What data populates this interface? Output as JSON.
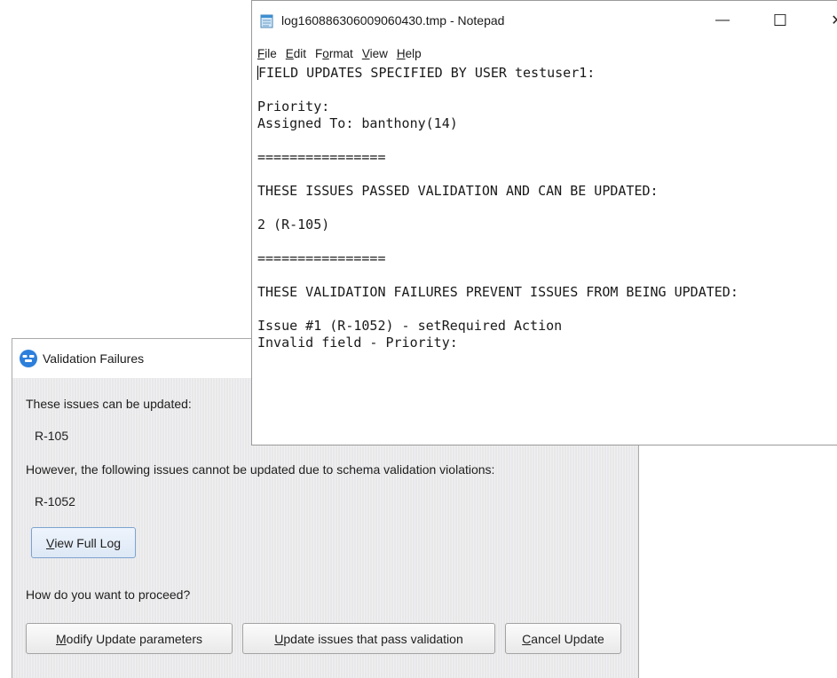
{
  "notepad": {
    "title": "log160886306009060430.tmp - Notepad",
    "window_controls": {
      "minimize": "—",
      "maximize": "☐",
      "close": "✕"
    },
    "menu": [
      {
        "pre": "",
        "mn": "F",
        "post": "ile"
      },
      {
        "pre": "",
        "mn": "E",
        "post": "dit"
      },
      {
        "pre": "F",
        "mn": "o",
        "post": "rmat"
      },
      {
        "pre": "",
        "mn": "V",
        "post": "iew"
      },
      {
        "pre": "",
        "mn": "H",
        "post": "elp"
      }
    ],
    "lines": [
      "FIELD UPDATES SPECIFIED BY USER testuser1:",
      "",
      "Priority:",
      "Assigned To: banthony(14)",
      "",
      "================",
      "",
      "THESE ISSUES PASSED VALIDATION AND CAN BE UPDATED:",
      "",
      "2 (R-105)",
      "",
      "================",
      "",
      "THESE VALIDATION FAILURES PREVENT ISSUES FROM BEING UPDATED:",
      "",
      "Issue #1 (R-1052) - setRequired Action",
      "Invalid field - Priority:"
    ]
  },
  "dialog": {
    "title": "Validation Failures",
    "icon": "app-logo-icon",
    "can_update_label": "These issues can be updated:",
    "can_update_issue": "R-105",
    "cannot_update_label": "However, the following issues cannot be updated due to schema validation violations:",
    "cannot_update_issue": "R-1052",
    "view_log_button": {
      "mn": "V",
      "rest": "iew Full Log"
    },
    "proceed_question": "How do you want to proceed?",
    "buttons": {
      "modify": {
        "mn": "M",
        "rest": "odify Update parameters"
      },
      "update_pass": {
        "mn": "U",
        "rest": "pdate issues that pass validation"
      },
      "cancel": {
        "mn": "C",
        "rest": "ancel Update"
      }
    }
  },
  "colors": {
    "dialog_body": "#e8e8ea",
    "accent_blue": "#2d7fdc"
  }
}
